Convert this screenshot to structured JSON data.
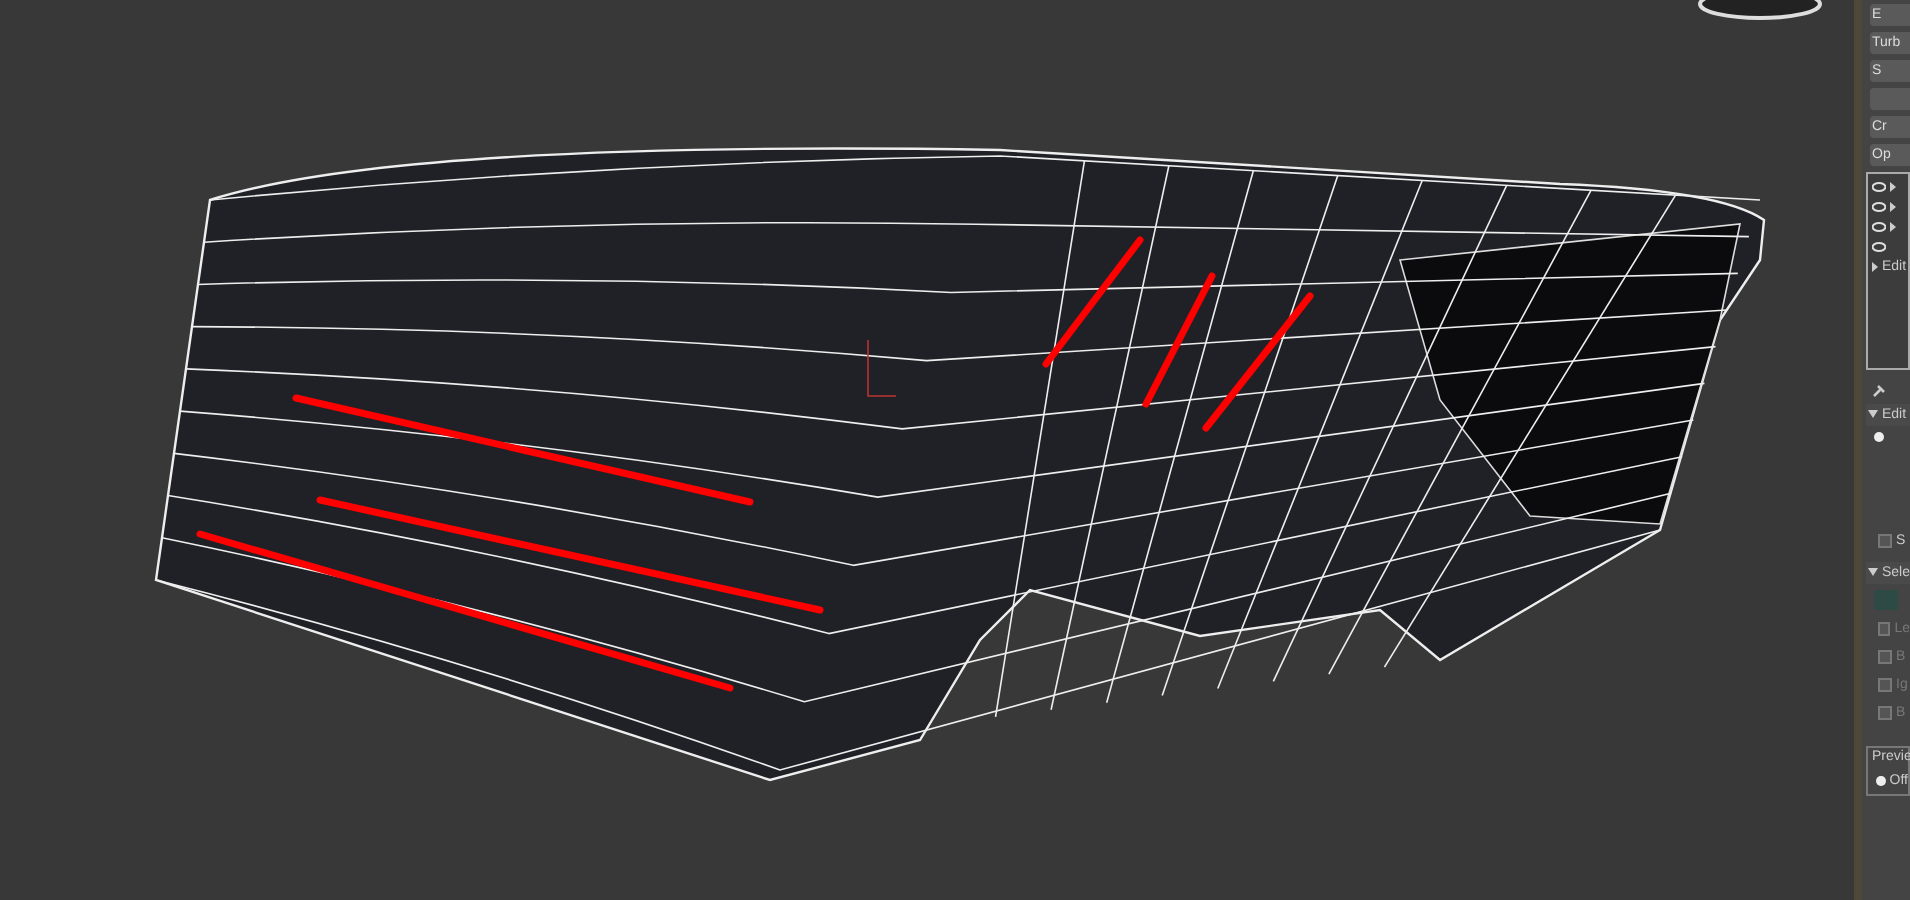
{
  "command_panel": {
    "buttons": [
      {
        "kind": "text",
        "label": "E"
      },
      {
        "kind": "text",
        "label": "Turb"
      },
      {
        "kind": "text",
        "label": "S"
      },
      {
        "kind": "blank"
      },
      {
        "kind": "text",
        "label": "Cr"
      },
      {
        "kind": "text",
        "label": "Op"
      }
    ],
    "modifier_stack": [
      {
        "eye": true,
        "expander": true
      },
      {
        "eye": true,
        "expander": true
      },
      {
        "eye": true,
        "expander": true
      },
      {
        "eye": true,
        "expander": false
      },
      {
        "eye": false,
        "expander": true,
        "label": "Edit"
      }
    ],
    "rollouts": [
      {
        "title": "Edit",
        "expanded": true,
        "radio": {
          "selected": true
        },
        "checkbox": {
          "label": "S",
          "checked": false
        }
      },
      {
        "title": "Sele",
        "expanded": true,
        "checkboxes": [
          {
            "label": "Le",
            "checked": false
          },
          {
            "label": "B",
            "checked": false
          },
          {
            "label": "Ig",
            "checked": false
          },
          {
            "label": "B",
            "checked": false
          }
        ]
      }
    ],
    "preview": {
      "title": "Previe",
      "option": {
        "label": "Off",
        "selected": true
      }
    }
  }
}
